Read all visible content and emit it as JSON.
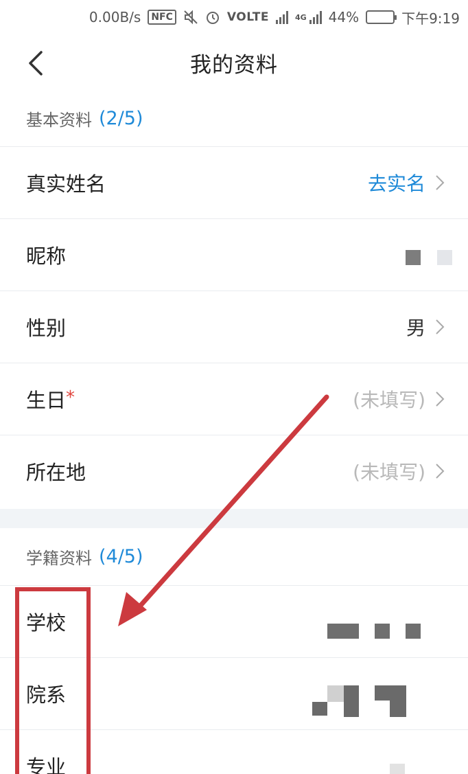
{
  "status_bar": {
    "net_speed": "0.00B/s",
    "nfc": "NFC",
    "volte": "VOLTE",
    "network": "4G",
    "battery": "44%",
    "battery_level": 0.44,
    "time": "下午9:19"
  },
  "header": {
    "title": "我的资料"
  },
  "basic_section": {
    "title": "基本资料",
    "count": "(2/5)",
    "rows": [
      {
        "label": "真实姓名",
        "value": "去实名"
      },
      {
        "label": "昵称",
        "value": ""
      },
      {
        "label": "性别",
        "value": "男"
      },
      {
        "label": "生日",
        "required_mark": "*",
        "value": "(未填写)"
      },
      {
        "label": "所在地",
        "value": "(未填写)"
      }
    ]
  },
  "academic_section": {
    "title": "学籍资料",
    "count": "(4/5)",
    "rows": [
      {
        "label": "学校"
      },
      {
        "label": "院系"
      },
      {
        "label": "专业"
      }
    ]
  },
  "colors": {
    "accent": "#1f8ad8",
    "required": "#e0443c",
    "annotation": "#cc3a3f",
    "divider_band": "#f1f4f7"
  }
}
